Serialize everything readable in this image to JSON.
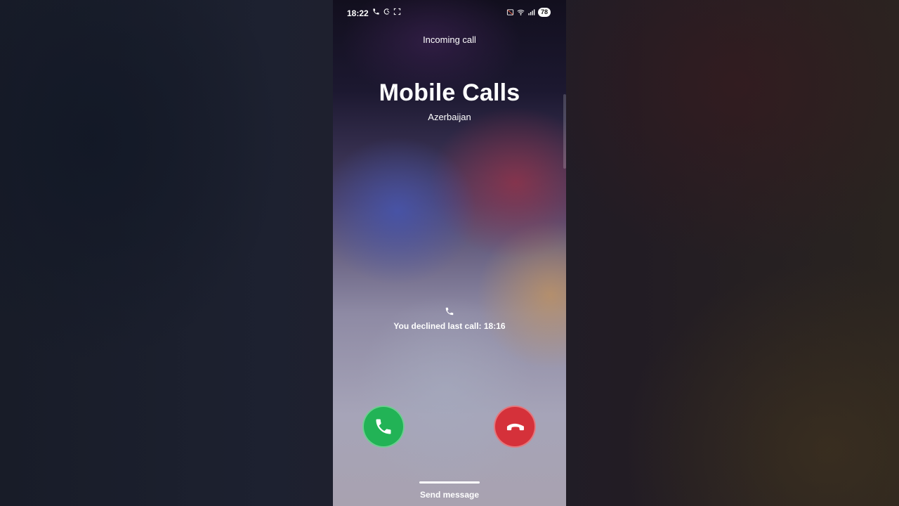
{
  "status_bar": {
    "time": "18:22",
    "battery": "78",
    "left_icons": [
      "phone-icon",
      "moon-crescent-icon",
      "screenshot-frame-icon"
    ],
    "right_icons": [
      "no-sim-icon",
      "wifi-icon",
      "signal-icon"
    ]
  },
  "call": {
    "label": "Incoming call",
    "caller_name": "Mobile Calls",
    "caller_location": "Azerbaijan",
    "last_call_note": "You declined last call: 18:16"
  },
  "actions": {
    "accept_icon": "phone-icon",
    "decline_icon": "phone-hangup-icon",
    "accept_color": "#22b356",
    "decline_color": "#d5313a"
  },
  "footer": {
    "send_message": "Send message"
  }
}
